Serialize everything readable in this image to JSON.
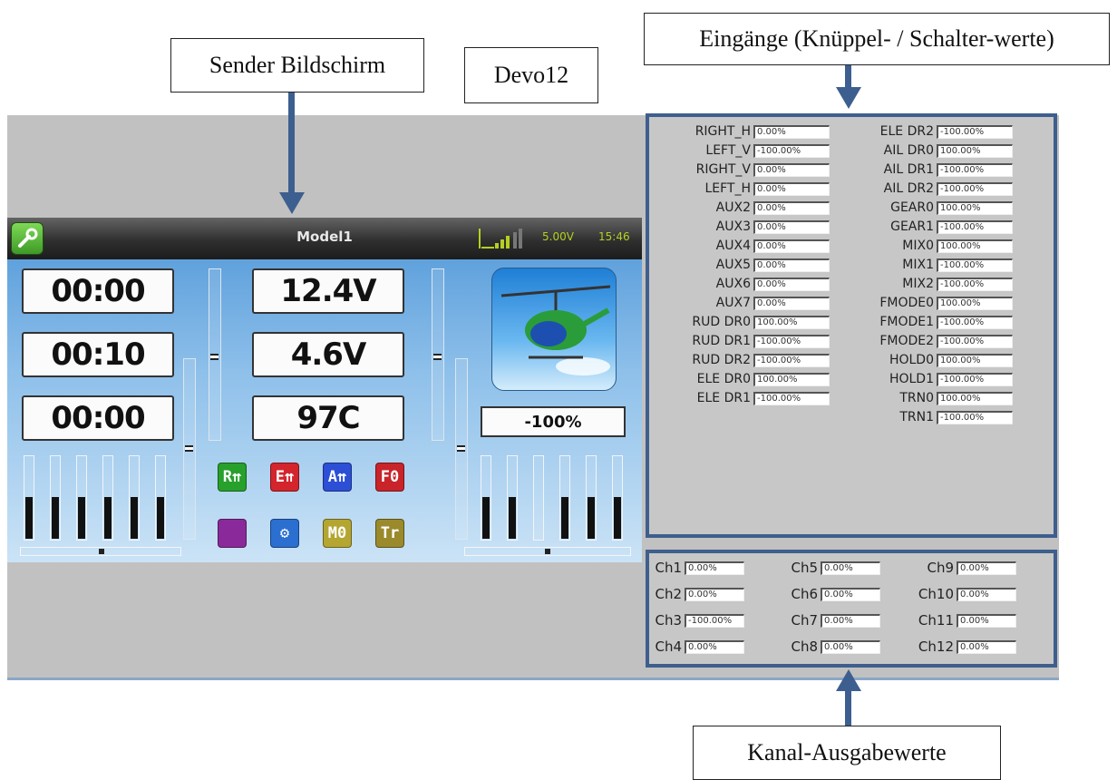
{
  "callouts": {
    "sender": "Sender Bildschirm",
    "device": "Devo12",
    "inputs": "Eingänge (Knüppel- / Schalter-werte)",
    "outputs": "Kanal-Ausgabewerte"
  },
  "colors": {
    "frame_blue": "#3e5f8d",
    "status_green": "#b6cf21",
    "sim_bg": "#c1c1c1"
  },
  "screen": {
    "model_name": "Model1",
    "battery": "5.00V",
    "time": "15:46",
    "signal_icon": "signal-bars-icon",
    "timers": [
      "00:00",
      "00:10",
      "00:00"
    ],
    "telemetry": [
      "12.4V",
      "4.6V",
      "97C"
    ],
    "percent": "-100%",
    "toggles": [
      {
        "label": "R⇈",
        "name": "rudder-dr-toggle",
        "color": "#27a02c"
      },
      {
        "label": "E⇈",
        "name": "elevator-dr-toggle",
        "color": "#d4242c"
      },
      {
        "label": "A⇈",
        "name": "aileron-dr-toggle",
        "color": "#2c4fd6"
      },
      {
        "label": "F0",
        "name": "flight-mode-toggle",
        "color": "#c8242a"
      },
      {
        "label": "",
        "name": "throttle-hold-toggle",
        "color": "#8a2a9a"
      },
      {
        "label": "⚙",
        "name": "settings-gear-toggle",
        "color": "#2b6fd0"
      },
      {
        "label": "M0",
        "name": "mix-toggle",
        "color": "#b5a531"
      },
      {
        "label": "Tr",
        "name": "trainer-toggle",
        "color": "#9a8a2c"
      }
    ],
    "left_channel_bars": [
      0.5,
      0.5,
      0.5,
      0.5,
      0.5,
      0.5
    ],
    "right_channel_bars": [
      0.5,
      0.5,
      0.0,
      0.5,
      0.5,
      0.5
    ]
  },
  "inputs_left": [
    {
      "label": "RIGHT_H",
      "value": "0.00%"
    },
    {
      "label": "LEFT_V",
      "value": "-100.00%"
    },
    {
      "label": "RIGHT_V",
      "value": "0.00%"
    },
    {
      "label": "LEFT_H",
      "value": "0.00%"
    },
    {
      "label": "AUX2",
      "value": "0.00%"
    },
    {
      "label": "AUX3",
      "value": "0.00%"
    },
    {
      "label": "AUX4",
      "value": "0.00%"
    },
    {
      "label": "AUX5",
      "value": "0.00%"
    },
    {
      "label": "AUX6",
      "value": "0.00%"
    },
    {
      "label": "AUX7",
      "value": "0.00%"
    },
    {
      "label": "RUD DR0",
      "value": "100.00%"
    },
    {
      "label": "RUD DR1",
      "value": "-100.00%"
    },
    {
      "label": "RUD DR2",
      "value": "-100.00%"
    },
    {
      "label": "ELE DR0",
      "value": "100.00%"
    },
    {
      "label": "ELE DR1",
      "value": "-100.00%"
    }
  ],
  "inputs_right": [
    {
      "label": "ELE DR2",
      "value": "-100.00%"
    },
    {
      "label": "AIL DR0",
      "value": "100.00%"
    },
    {
      "label": "AIL DR1",
      "value": "-100.00%"
    },
    {
      "label": "AIL DR2",
      "value": "-100.00%"
    },
    {
      "label": "GEAR0",
      "value": "100.00%"
    },
    {
      "label": "GEAR1",
      "value": "-100.00%"
    },
    {
      "label": "MIX0",
      "value": "100.00%"
    },
    {
      "label": "MIX1",
      "value": "-100.00%"
    },
    {
      "label": "MIX2",
      "value": "-100.00%"
    },
    {
      "label": "FMODE0",
      "value": "100.00%"
    },
    {
      "label": "FMODE1",
      "value": "-100.00%"
    },
    {
      "label": "FMODE2",
      "value": "-100.00%"
    },
    {
      "label": "HOLD0",
      "value": "100.00%"
    },
    {
      "label": "HOLD1",
      "value": "-100.00%"
    },
    {
      "label": "TRN0",
      "value": "100.00%"
    },
    {
      "label": "TRN1",
      "value": "-100.00%"
    }
  ],
  "channels": [
    {
      "label": "Ch1",
      "value": "0.00%"
    },
    {
      "label": "Ch2",
      "value": "0.00%"
    },
    {
      "label": "Ch3",
      "value": "-100.00%"
    },
    {
      "label": "Ch4",
      "value": "0.00%"
    },
    {
      "label": "Ch5",
      "value": "0.00%"
    },
    {
      "label": "Ch6",
      "value": "0.00%"
    },
    {
      "label": "Ch7",
      "value": "0.00%"
    },
    {
      "label": "Ch8",
      "value": "0.00%"
    },
    {
      "label": "Ch9",
      "value": "0.00%"
    },
    {
      "label": "Ch10",
      "value": "0.00%"
    },
    {
      "label": "Ch11",
      "value": "0.00%"
    },
    {
      "label": "Ch12",
      "value": "0.00%"
    }
  ]
}
